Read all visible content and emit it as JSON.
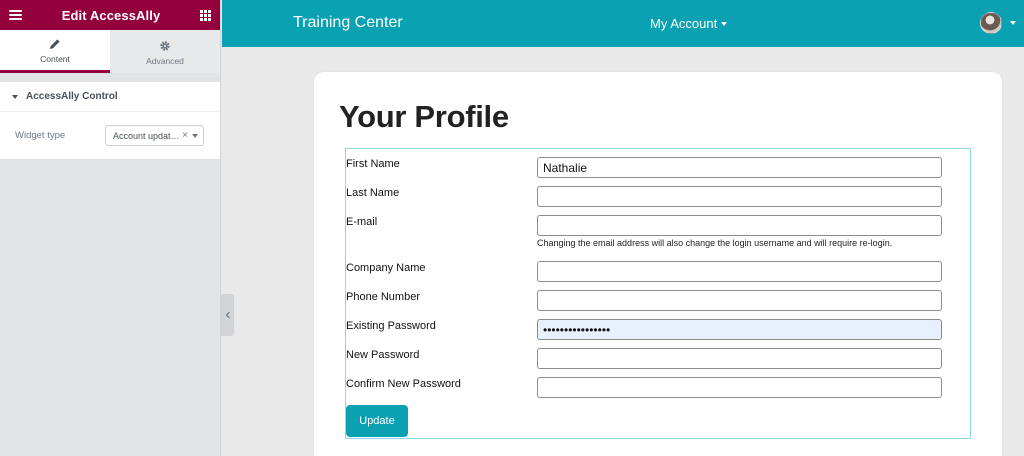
{
  "editor": {
    "title": "Edit AccessAlly",
    "tabs": [
      {
        "label": "Content",
        "icon": "pencil-icon",
        "active": true
      },
      {
        "label": "Advanced",
        "icon": "gear-icon",
        "active": false
      }
    ],
    "section": {
      "title": "AccessAlly Control",
      "widget_type_label": "Widget type",
      "widget_type_value": "Account updat…"
    },
    "accent_color": "#93003c"
  },
  "site": {
    "title": "Training Center",
    "account_menu": "My Account",
    "brand_color": "#0aa2b3"
  },
  "profile": {
    "title": "Your Profile",
    "fields": [
      {
        "label": "First Name",
        "value": "Nathalie",
        "type": "text"
      },
      {
        "label": "Last Name",
        "value": "",
        "type": "text"
      },
      {
        "label": "E-mail",
        "value": "",
        "type": "email"
      },
      {
        "label": "Company Name",
        "value": "",
        "type": "text"
      },
      {
        "label": "Phone Number",
        "value": "",
        "type": "text"
      },
      {
        "label": "Existing Password",
        "value": "••••••••••••••••",
        "type": "text"
      },
      {
        "label": "New Password",
        "value": "",
        "type": "password"
      },
      {
        "label": "Confirm New Password",
        "value": "",
        "type": "password"
      }
    ],
    "email_help": "Changing the email address will also change the login username and will require re-login.",
    "submit_label": "Update"
  }
}
